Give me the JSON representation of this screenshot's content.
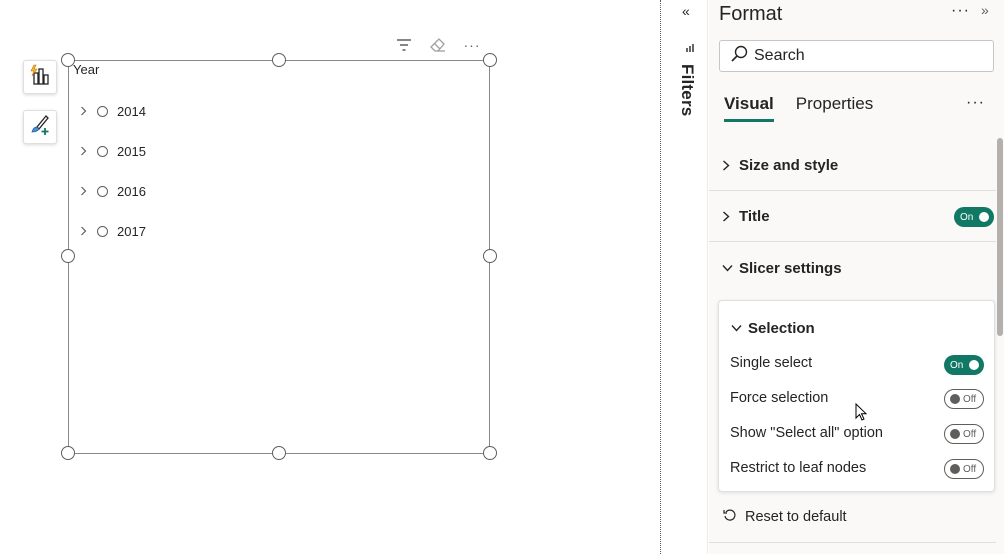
{
  "canvas": {
    "toolbar": {
      "filter_icon": "filter-icon",
      "eraser_icon": "eraser-icon",
      "more_label": "···"
    },
    "side_buttons": {
      "build_icon": "build-visual-icon",
      "format_icon": "format-visual-icon"
    },
    "slicer": {
      "header": "Year",
      "items": [
        {
          "label": "2014"
        },
        {
          "label": "2015"
        },
        {
          "label": "2016"
        },
        {
          "label": "2017"
        }
      ]
    }
  },
  "filters_rail": {
    "collapse_label": "«",
    "label": "Filters"
  },
  "format_pane": {
    "title": "Format",
    "more_label": "···",
    "expand_label": "»",
    "search": {
      "placeholder": "Search"
    },
    "tabs": [
      {
        "label": "Visual",
        "active": true
      },
      {
        "label": "Properties",
        "active": false
      }
    ],
    "tabs_more": "···",
    "sections": {
      "size_style": {
        "label": "Size and style"
      },
      "title": {
        "label": "Title",
        "toggle": "On"
      },
      "slicer_settings": {
        "label": "Slicer settings"
      }
    },
    "selection_card": {
      "header": "Selection",
      "rows": [
        {
          "label": "Single select",
          "toggle": "On"
        },
        {
          "label": "Force selection",
          "toggle": "Off"
        },
        {
          "label": "Show \"Select all\" option",
          "toggle": "Off"
        },
        {
          "label": "Restrict to leaf nodes",
          "toggle": "Off"
        }
      ]
    },
    "reset": {
      "label": "Reset to default"
    }
  },
  "colors": {
    "accent": "#117865",
    "border": "#8a8886",
    "pane_bg": "#faf9f8"
  }
}
